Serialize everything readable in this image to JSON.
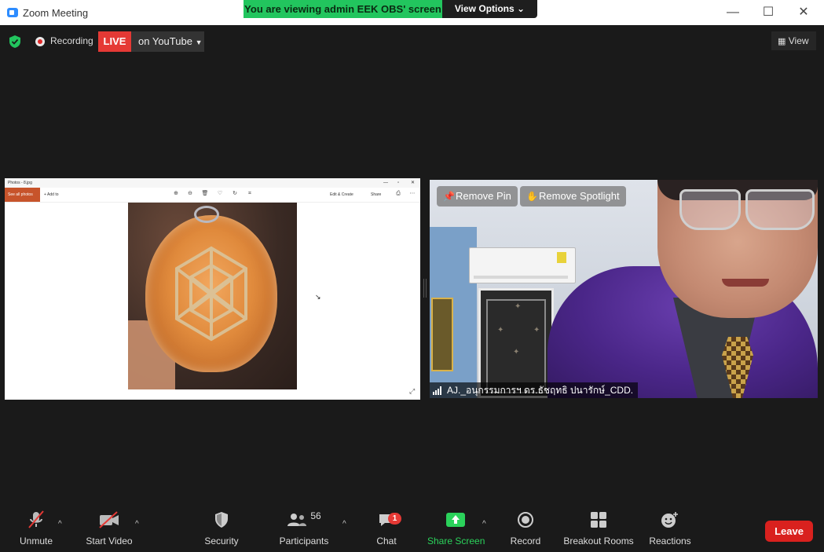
{
  "window": {
    "title": "Zoom Meeting",
    "share_banner": "You are viewing admin EEK OBS' screen",
    "view_options": "View Options",
    "controls": {
      "minimize": "—",
      "maximize": "☐",
      "close": "✕"
    }
  },
  "status_bar": {
    "recording_label": "Recording",
    "live_badge": "LIVE",
    "live_target": "on YouTube",
    "view_label": "View"
  },
  "shared_screen": {
    "photos_title": "Photos - 8.jpg",
    "see_all_photos": "See all photos",
    "add_to": "Add to",
    "edit_create": "Edit & Create",
    "share": "Share"
  },
  "speaker": {
    "remove_pin": "Remove Pin",
    "remove_spotlight": "Remove Spotlight",
    "name": "AJ._อนุกรรมการฯ ดร.ธัชฤทธิ ปนารักษ์_CDD."
  },
  "toolbar": {
    "unmute": "Unmute",
    "start_video": "Start Video",
    "security": "Security",
    "participants": "Participants",
    "participants_count": "56",
    "chat": "Chat",
    "chat_badge": "1",
    "share_screen": "Share Screen",
    "record": "Record",
    "breakout_rooms": "Breakout Rooms",
    "reactions": "Reactions",
    "leave": "Leave"
  },
  "colors": {
    "accent": "#2d8cff",
    "share_green": "#22c55e",
    "live_red": "#e53935",
    "leave_red": "#d9211e"
  }
}
